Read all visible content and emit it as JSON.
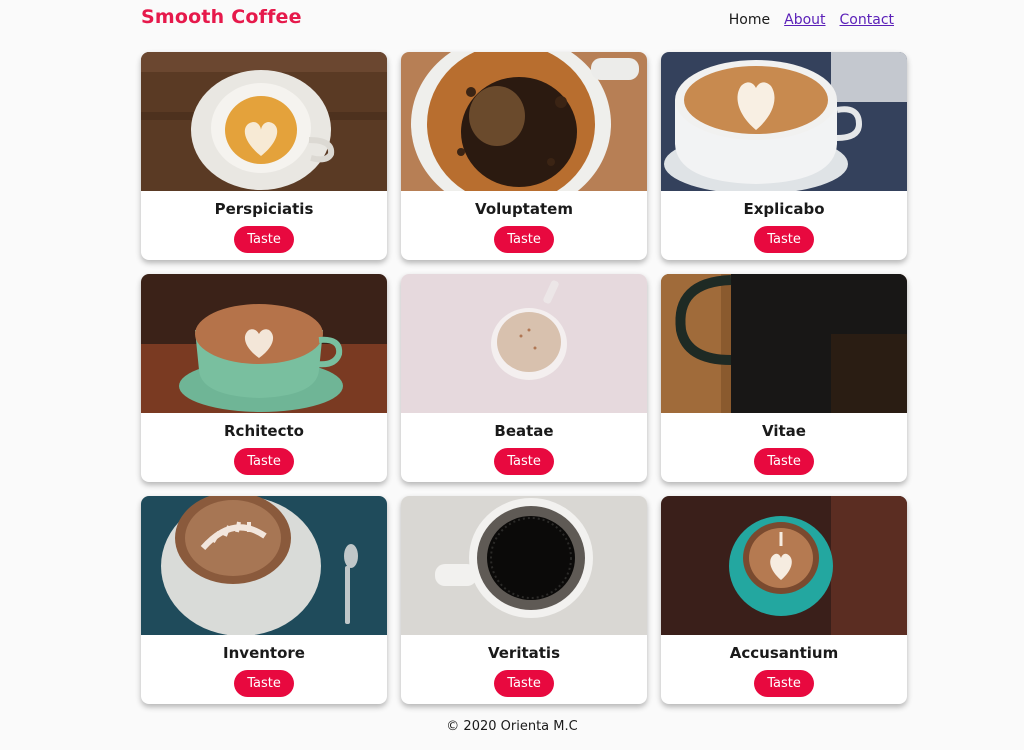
{
  "header": {
    "brand": "Smooth Coffee",
    "nav": [
      "Home",
      "About",
      "Contact"
    ]
  },
  "cards": [
    {
      "title": "Perspiciatis",
      "button": "Taste",
      "photo": "latte-heart-cup-icon"
    },
    {
      "title": "Voluptatem",
      "button": "Taste",
      "photo": "black-coffee-foam-icon"
    },
    {
      "title": "Explicabo",
      "button": "Taste",
      "photo": "latte-art-cup-icon"
    },
    {
      "title": "Rchitecto",
      "button": "Taste",
      "photo": "latte-heart-green-cup-icon"
    },
    {
      "title": "Beatae",
      "button": "Taste",
      "photo": "small-coffee-cup-icon"
    },
    {
      "title": "Vitae",
      "button": "Taste",
      "photo": "dark-mug-icon"
    },
    {
      "title": "Inventore",
      "button": "Taste",
      "photo": "cappuccino-leaf-art-icon"
    },
    {
      "title": "Veritatis",
      "button": "Taste",
      "photo": "black-coffee-topview-icon"
    },
    {
      "title": "Accusantium",
      "button": "Taste",
      "photo": "latte-teal-cup-icon"
    }
  ],
  "footer": "© 2020 Orienta M.C",
  "colors": {
    "brand": "#e6194b",
    "button": "#e8093f",
    "link": "#5a1fb8"
  }
}
